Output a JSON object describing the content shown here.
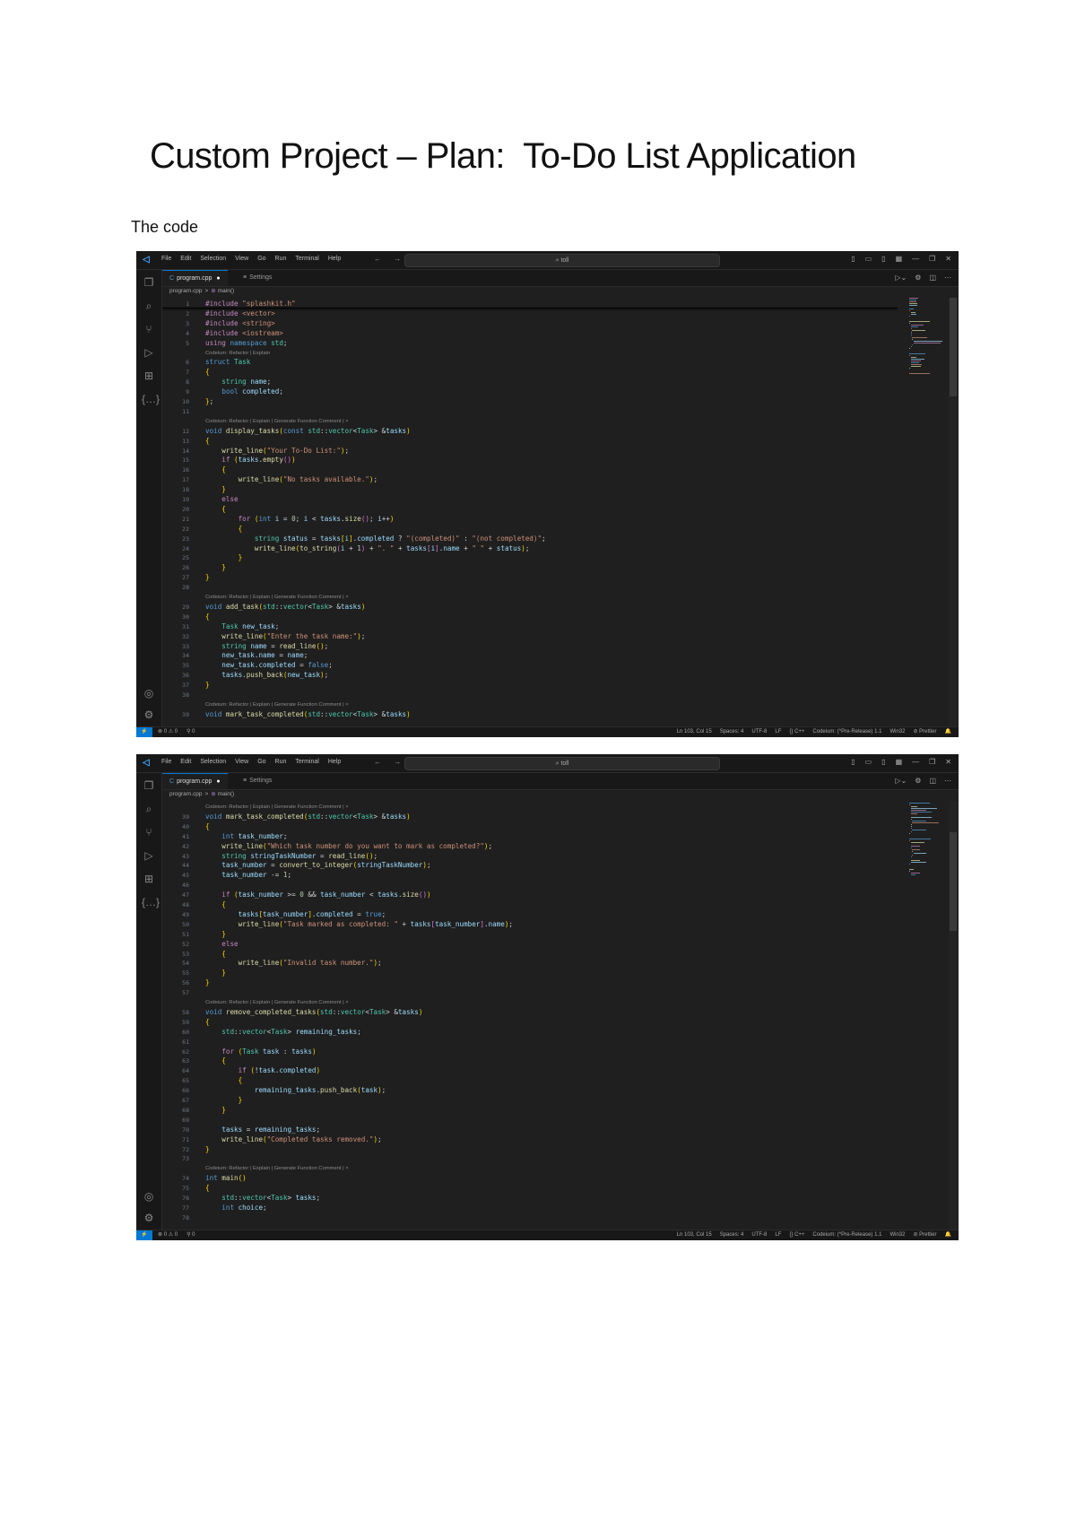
{
  "document": {
    "title": "Custom Project – Plan:  To-Do List Application",
    "subtitle": "The code"
  },
  "colors": {
    "accent": "#0078d4",
    "editor_bg": "#1f1f1f",
    "chrome_bg": "#181818"
  },
  "windows": [
    {
      "menu": [
        "File",
        "Edit",
        "Selection",
        "View",
        "Go",
        "Run",
        "Terminal",
        "Help"
      ],
      "nav": "← →",
      "search": "⌕ toll",
      "window_controls": [
        "▯",
        "▭",
        "▯",
        "▦",
        "—",
        "❐",
        "✕"
      ],
      "tabs": [
        {
          "icon": "C",
          "label": "program.cpp",
          "dirty": "●"
        },
        {
          "icon": "≡",
          "label": "Settings"
        }
      ],
      "tab_tools": [
        "▷⌄",
        "⚙",
        "◫",
        "⋯"
      ],
      "breadcrumb": {
        "file": "program.cpp",
        "sep": ">",
        "symbol_icon": "⊛",
        "symbol": "main()"
      },
      "editor": {
        "lines": [
          {
            "n": "1",
            "code": "#include \"splashkit.h\""
          },
          {
            "n": "2",
            "code": "#include <vector>"
          },
          {
            "n": "3",
            "code": "#include <string>"
          },
          {
            "n": "4",
            "code": "#include <iostream>"
          },
          {
            "n": "5",
            "code": "using namespace std;"
          },
          {
            "lens": "Codeium: Refactor | Explain"
          },
          {
            "n": "6",
            "code": "struct Task"
          },
          {
            "n": "7",
            "code": "{"
          },
          {
            "n": "8",
            "code": "    string name;"
          },
          {
            "n": "9",
            "code": "    bool completed;"
          },
          {
            "n": "10",
            "code": "};"
          },
          {
            "n": "11",
            "code": ""
          },
          {
            "lens": "Codeium: Refactor | Explain | Generate Function Comment | ×"
          },
          {
            "n": "12",
            "code": "void display_tasks(const std::vector<Task> &tasks)"
          },
          {
            "n": "13",
            "code": "{"
          },
          {
            "n": "14",
            "code": "    write_line(\"Your To-Do List:\");"
          },
          {
            "n": "15",
            "code": "    if (tasks.empty())"
          },
          {
            "n": "16",
            "code": "    {"
          },
          {
            "n": "17",
            "code": "        write_line(\"No tasks available.\");"
          },
          {
            "n": "18",
            "code": "    }"
          },
          {
            "n": "19",
            "code": "    else"
          },
          {
            "n": "20",
            "code": "    {"
          },
          {
            "n": "21",
            "code": "        for (int i = 0; i < tasks.size(); i++)"
          },
          {
            "n": "22",
            "code": "        {"
          },
          {
            "n": "23",
            "code": "            string status = tasks[i].completed ? \"(completed)\" : \"(not completed)\";"
          },
          {
            "n": "24",
            "code": "            write_line(to_string(i + 1) + \". \" + tasks[i].name + \" \" + status);"
          },
          {
            "n": "25",
            "code": "        }"
          },
          {
            "n": "26",
            "code": "    }"
          },
          {
            "n": "27",
            "code": "}"
          },
          {
            "n": "28",
            "code": ""
          },
          {
            "lens": "Codeium: Refactor | Explain | Generate Function Comment | ×"
          },
          {
            "n": "29",
            "code": "void add_task(std::vector<Task> &tasks)"
          },
          {
            "n": "30",
            "code": "{"
          },
          {
            "n": "31",
            "code": "    Task new_task;"
          },
          {
            "n": "32",
            "code": "    write_line(\"Enter the task name:\");"
          },
          {
            "n": "33",
            "code": "    string name = read_line();"
          },
          {
            "n": "34",
            "code": "    new_task.name = name;"
          },
          {
            "n": "35",
            "code": "    new_task.completed = false;"
          },
          {
            "n": "36",
            "code": "    tasks.push_back(new_task);"
          },
          {
            "n": "37",
            "code": "}"
          },
          {
            "n": "38",
            "code": ""
          },
          {
            "lens": "Codeium: Refactor | Explain | Generate Function Comment | ×"
          },
          {
            "n": "39",
            "code": "void mark_task_completed(std::vector<Task> &tasks)"
          }
        ],
        "scroll_position": 0.0
      },
      "status": {
        "remote": "⚡",
        "left": [
          "⊗ 0 ⚠ 0",
          "⚲ 0"
        ],
        "right": [
          "Ln 103, Col 15",
          "Spaces: 4",
          "UTF-8",
          "LF",
          "{} C++",
          "Codeium: (*Pre-Release) 1.1",
          "Win32",
          "⊘ Prettier",
          "🔔"
        ]
      }
    },
    {
      "menu": [
        "File",
        "Edit",
        "Selection",
        "View",
        "Go",
        "Run",
        "Terminal",
        "Help"
      ],
      "nav": "← →",
      "search": "⌕ toll",
      "window_controls": [
        "▯",
        "▭",
        "▯",
        "▦",
        "—",
        "❐",
        "✕"
      ],
      "tabs": [
        {
          "icon": "C",
          "label": "program.cpp",
          "dirty": "●"
        },
        {
          "icon": "≡",
          "label": "Settings"
        }
      ],
      "tab_tools": [
        "▷⌄",
        "⚙",
        "◫",
        "⋯"
      ],
      "breadcrumb": {
        "file": "program.cpp",
        "sep": ">",
        "symbol_icon": "⊛",
        "symbol": "main()"
      },
      "editor": {
        "lines": [
          {
            "lens": "Codeium: Refactor | Explain | Generate Function Comment | ×"
          },
          {
            "n": "39",
            "code": "void mark_task_completed(std::vector<Task> &tasks)"
          },
          {
            "n": "40",
            "code": "{"
          },
          {
            "n": "41",
            "code": "    int task_number;"
          },
          {
            "n": "42",
            "code": "    write_line(\"Which task number do you want to mark as completed?\");"
          },
          {
            "n": "43",
            "code": "    string stringTaskNumber = read_line();"
          },
          {
            "n": "44",
            "code": "    task_number = convert_to_integer(stringTaskNumber);"
          },
          {
            "n": "45",
            "code": "    task_number -= 1;"
          },
          {
            "n": "46",
            "code": ""
          },
          {
            "n": "47",
            "code": "    if (task_number >= 0 && task_number < tasks.size())"
          },
          {
            "n": "48",
            "code": "    {"
          },
          {
            "n": "49",
            "code": "        tasks[task_number].completed = true;"
          },
          {
            "n": "50",
            "code": "        write_line(\"Task marked as completed: \" + tasks[task_number].name);"
          },
          {
            "n": "51",
            "code": "    }"
          },
          {
            "n": "52",
            "code": "    else"
          },
          {
            "n": "53",
            "code": "    {"
          },
          {
            "n": "54",
            "code": "        write_line(\"Invalid task number.\");"
          },
          {
            "n": "55",
            "code": "    }"
          },
          {
            "n": "56",
            "code": "}"
          },
          {
            "n": "57",
            "code": ""
          },
          {
            "lens": "Codeium: Refactor | Explain | Generate Function Comment | ×"
          },
          {
            "n": "58",
            "code": "void remove_completed_tasks(std::vector<Task> &tasks)"
          },
          {
            "n": "59",
            "code": "{"
          },
          {
            "n": "60",
            "code": "    std::vector<Task> remaining_tasks;"
          },
          {
            "n": "61",
            "code": ""
          },
          {
            "n": "62",
            "code": "    for (Task task : tasks)"
          },
          {
            "n": "63",
            "code": "    {"
          },
          {
            "n": "64",
            "code": "        if (!task.completed)"
          },
          {
            "n": "65",
            "code": "        {"
          },
          {
            "n": "66",
            "code": "            remaining_tasks.push_back(task);"
          },
          {
            "n": "67",
            "code": "        }"
          },
          {
            "n": "68",
            "code": "    }"
          },
          {
            "n": "69",
            "code": ""
          },
          {
            "n": "70",
            "code": "    tasks = remaining_tasks;"
          },
          {
            "n": "71",
            "code": "    write_line(\"Completed tasks removed.\");"
          },
          {
            "n": "72",
            "code": "}"
          },
          {
            "n": "73",
            "code": ""
          },
          {
            "lens": "Codeium: Refactor | Explain | Generate Function Comment | ×"
          },
          {
            "n": "74",
            "code": "int main()"
          },
          {
            "n": "75",
            "code": "{"
          },
          {
            "n": "76",
            "code": "    std::vector<Task> tasks;"
          },
          {
            "n": "77",
            "code": "    int choice;"
          },
          {
            "n": "78",
            "code": ""
          }
        ],
        "scroll_position": 0.35
      },
      "status": {
        "remote": "⚡",
        "left": [
          "⊗ 0 ⚠ 0",
          "⚲ 0"
        ],
        "right": [
          "Ln 103, Col 15",
          "Spaces: 4",
          "UTF-8",
          "LF",
          "{} C++",
          "Codeium: (*Pre-Release) 1.1",
          "Win32",
          "⊘ Prettier",
          "🔔"
        ]
      }
    }
  ]
}
